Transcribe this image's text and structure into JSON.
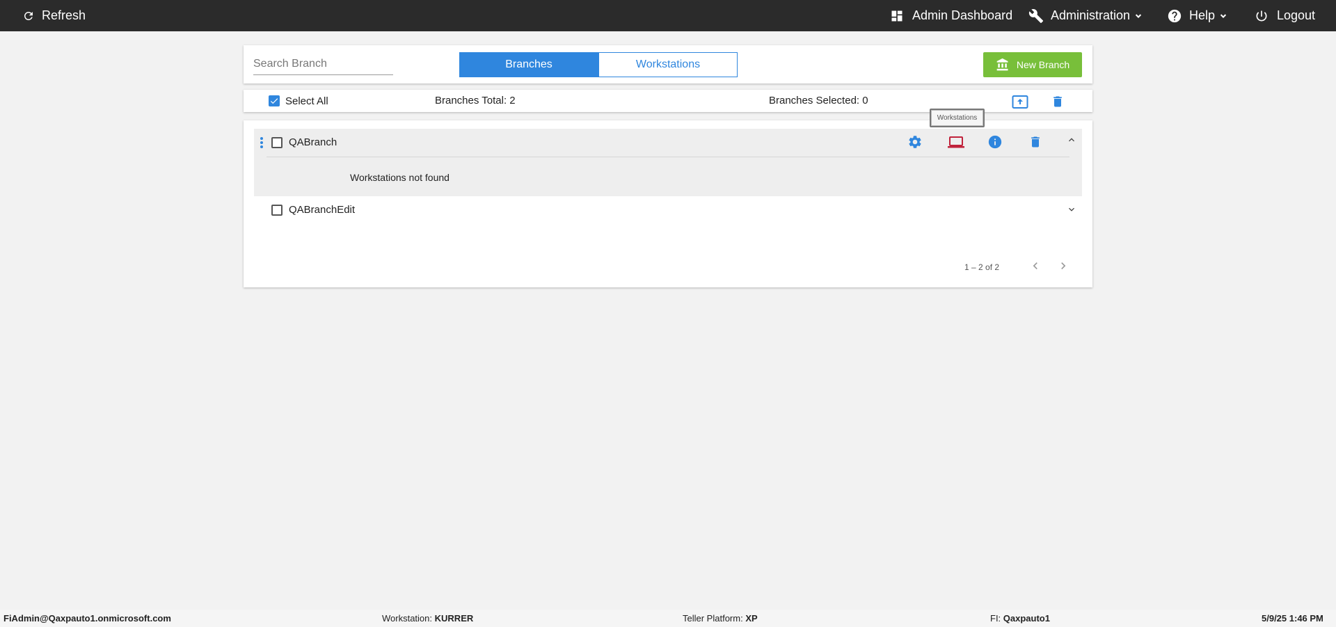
{
  "topbar": {
    "refresh_label": "Refresh",
    "dashboard_label": "Admin Dashboard",
    "administration_label": "Administration",
    "help_label": "Help",
    "logout_label": "Logout",
    "background": "#2b2b2b"
  },
  "toolbar": {
    "search_placeholder": "Search Branch",
    "search_value": "",
    "tabs": [
      {
        "label": "Branches",
        "active": true
      },
      {
        "label": "Workstations",
        "active": false
      }
    ],
    "new_branch_label": "New Branch",
    "accent": "#2f86de",
    "new_branch_color": "#78bf3a"
  },
  "summary": {
    "select_all_label": "Select All",
    "select_all_checked": true,
    "branches_total": "Branches Total: 2",
    "branches_selected": "Branches Selected: 0"
  },
  "tooltip": {
    "text": "Workstations"
  },
  "branches": [
    {
      "name": "QABranch",
      "expanded": true,
      "checked": false,
      "detail": "Workstations not found"
    },
    {
      "name": "QABranchEdit",
      "expanded": false,
      "checked": false
    }
  ],
  "pagination": {
    "range_text": "1 – 2 of 2"
  },
  "icons": {
    "refresh": "refresh-icon",
    "dashboard": "dashboard-icon",
    "administration": "wrench-icon",
    "help": "help-circle-icon",
    "logout": "power-icon",
    "new_branch": "bank-icon",
    "export": "export-icon",
    "delete": "trash-icon",
    "settings": "gear-icon",
    "workstations": "laptop-icon",
    "info": "info-icon"
  },
  "statusbar": {
    "user": "FiAdmin@Qaxpauto1.onmicrosoft.com",
    "workstation_label": "Workstation:",
    "workstation_value": "KURRER",
    "teller_platform_label": "Teller Platform:",
    "teller_platform_value": "XP",
    "fi_label": "FI:",
    "fi_value": "Qaxpauto1",
    "datetime": "5/9/25 1:46 PM"
  }
}
